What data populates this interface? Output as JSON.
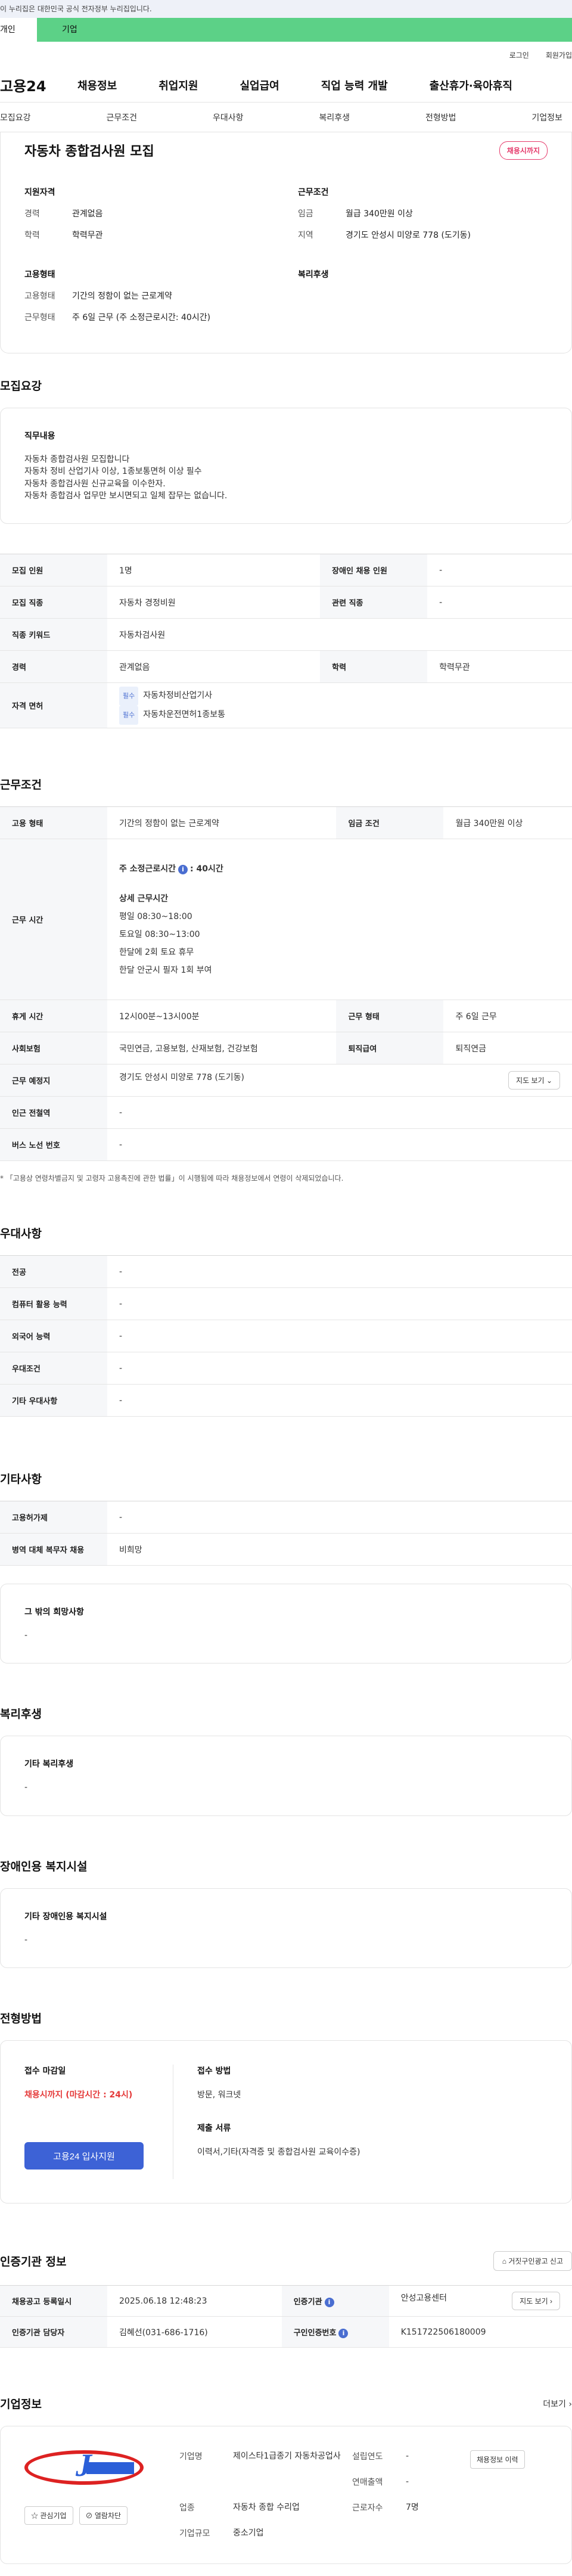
{
  "gov_banner": "이 누리집은 대한민국 공식 전자정부 누리집입니다.",
  "user_tabs": {
    "personal": "개인",
    "company": "기업"
  },
  "util": {
    "login": "로그인",
    "signup": "회원가입"
  },
  "gnb": {
    "logo": "고용24",
    "items": [
      "채용정보",
      "취업지원",
      "실업급여",
      "직업 능력 개발",
      "출산휴가·육아휴직"
    ]
  },
  "anchor_tabs": [
    "모집요강",
    "근무조건",
    "우대사항",
    "복리후생",
    "전형방법",
    "기업정보"
  ],
  "summary": {
    "title": "자동차 종합검사원 모집",
    "deadline_badge": "채용시까지",
    "qual": {
      "heading": "지원자격",
      "rows": [
        {
          "k": "경력",
          "v": "관계없음"
        },
        {
          "k": "학력",
          "v": "학력무관"
        }
      ]
    },
    "cond": {
      "heading": "근무조건",
      "rows": [
        {
          "k": "임금",
          "v": "월급 340만원 이상"
        },
        {
          "k": "지역",
          "v": "경기도 안성시 미양로 778 (도기동)"
        }
      ]
    },
    "emp": {
      "heading": "고용형태",
      "rows": [
        {
          "k": "고용형태",
          "v": "기간의 정함이 없는 근로계약"
        },
        {
          "k": "근무형태",
          "v": "주 6일 근무 (주 소정근로시간: 40시간)"
        }
      ]
    },
    "welfare": {
      "heading": "복리후생"
    }
  },
  "recruit": {
    "title": "모집요강",
    "duty_heading": "직무내용",
    "duty_lines": [
      "자동차 종합검사원 모집합니다",
      "자동차 정비 산업기사 이상, 1종보통면허 이상 필수",
      "자동차 종합검사원 신규교육을 이수한자.",
      "자동차 종합검사 업무만 보시면되고 일체 잡무는 없습니다."
    ],
    "table": {
      "count_h": "모집 인원",
      "count": "1명",
      "disabled_h": "장애인 채용 인원",
      "disabled": "-",
      "job_h": "모집 직종",
      "job": "자동차 경정비원",
      "rel_h": "관련 직종",
      "rel": "-",
      "kw_h": "직종 키워드",
      "kw": "자동차검사원",
      "career_h": "경력",
      "career": "관계없음",
      "edu_h": "학력",
      "edu": "학력무관",
      "lic_h": "자격 면허",
      "lic_tag": "필수",
      "lic1": "자동차정비산업기사",
      "lic2": "자동차운전면허1종보통"
    }
  },
  "work": {
    "title": "근무조건",
    "emp_h": "고용 형태",
    "emp": "기간의 정함이 없는 근로계약",
    "wage_h": "임금 조건",
    "wage": "월급 340만원 이상",
    "time_h": "근무 시간",
    "time_total_label": "주 소정근로시간",
    "time_total_value": ": 40시간",
    "detail_heading": "상세 근무시간",
    "detail_lines": [
      "평일 08:30~18:00",
      "토요일 08:30~13:00",
      "한달에 2회 토요 휴무",
      "한달 안군시 필자 1회 부여"
    ],
    "break_h": "휴게 시간",
    "break": "12시00분~13시00분",
    "form_h": "근무 형태",
    "form": "주 6일 근무",
    "ins_h": "사회보험",
    "ins": "국민연금, 고용보험, 산재보험, 건강보험",
    "sev_h": "퇴직급여",
    "sev": "퇴직연금",
    "place_h": "근무 예정지",
    "place": "경기도 안성시 미양로 778 (도기동)",
    "map_btn": "지도 보기",
    "station_h": "인근 전철역",
    "station": "-",
    "bus_h": "버스 노선 번호",
    "bus": "-",
    "note": "* 「고용상 연령차별금지 및 고령자 고용촉진에 관한 법률」이 시행됨에 따라 채용정보에서 연령이 삭제되었습니다."
  },
  "pref": {
    "title": "우대사항",
    "rows": [
      {
        "h": "전공",
        "v": "-"
      },
      {
        "h": "컴퓨터 활용 능력",
        "v": "-"
      },
      {
        "h": "외국어 능력",
        "v": "-"
      },
      {
        "h": "우대조건",
        "v": "-"
      },
      {
        "h": "기타 우대사항",
        "v": "-"
      }
    ]
  },
  "etc": {
    "title": "기타사항",
    "rows": [
      {
        "h": "고용허가제",
        "v": "-"
      },
      {
        "h": "병역 대체 복무자 채용",
        "v": "비희망"
      }
    ],
    "wish_heading": "그 밖의 희망사항",
    "wish": "-"
  },
  "welfare": {
    "title": "복리후생",
    "heading": "기타 복리후생",
    "value": "-"
  },
  "facility": {
    "title": "장애인용 복지시설",
    "heading": "기타 장애인용 복지시설",
    "value": "-"
  },
  "process": {
    "title": "전형방법",
    "deadline_heading": "접수 마감일",
    "deadline": "채용시까지 (마감시간 : 24시)",
    "apply_btn": "고용24 입사지원",
    "method_heading": "접수 방법",
    "method": "방문, 워크넷",
    "docs_heading": "제출 서류",
    "docs": "이력서,기타(자격증 및 종합검사원 교육이수증)"
  },
  "cert": {
    "title": "인증기관 정보",
    "report_btn": "거짓구인광고 신고",
    "reg_h": "채용공고 등록일시",
    "reg": "2025.06.18 12:48:23",
    "org_h": "인증기관",
    "org": "안성고용센터",
    "mgr_h": "인증기관 담당자",
    "mgr": "김혜선(031-686-1716)",
    "no_h": "구인인증번호",
    "no": "K151722506180009",
    "map_btn": "지도 보기"
  },
  "company": {
    "title": "기업정보",
    "more": "더보기",
    "fav_btn": "관심기업",
    "block_btn": "열람차단",
    "name_k": "기업명",
    "name_v": "제이스타1급종기 자동차공업사",
    "found_k": "설립연도",
    "found_v": "-",
    "sales_k": "연매출액",
    "sales_v": "-",
    "ind_k": "업종",
    "ind_v": "자동차 종합 수리업",
    "emp_k": "근로자수",
    "emp_v": "7명",
    "size_k": "기업규모",
    "size_v": "중소기업",
    "history_btn": "채용정보 이력"
  }
}
